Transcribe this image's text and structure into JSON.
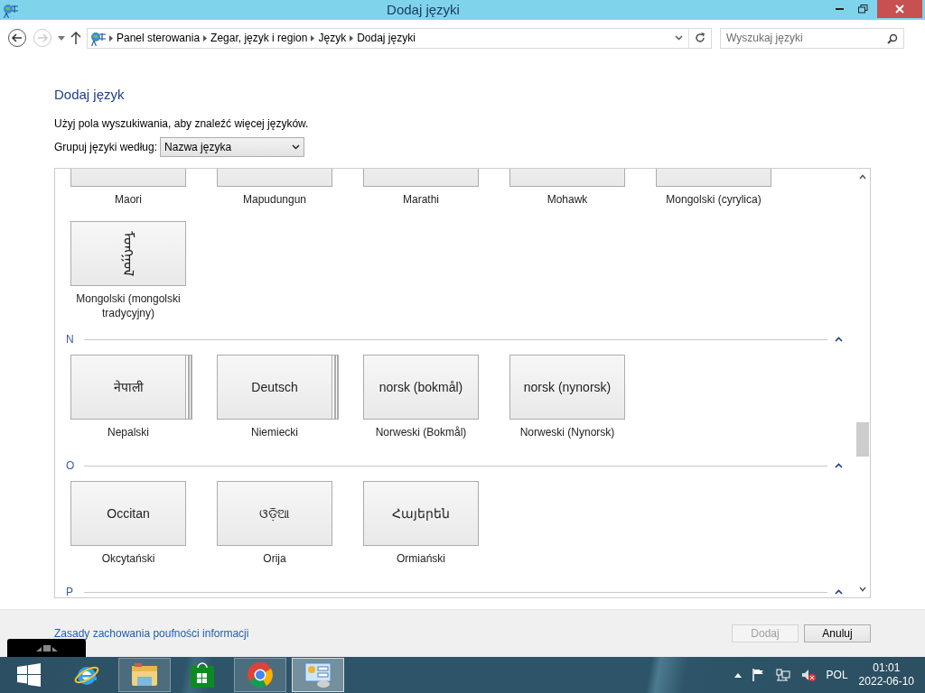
{
  "window": {
    "title": "Dodaj języki"
  },
  "address_bar": {
    "breadcrumbs": [
      "Panel sterowania",
      "Zegar, język i region",
      "Język",
      "Dodaj języki"
    ]
  },
  "search": {
    "placeholder": "Wyszukaj języki"
  },
  "heading": "Dodaj język",
  "hint": "Użyj pola wyszukiwania, aby znaleźć więcej języków.",
  "group_by": {
    "label": "Grupuj języki według:",
    "value": "Nazwa języka"
  },
  "groups": [
    {
      "items": [
        {
          "label": "Maori",
          "kind": "single"
        },
        {
          "label": "Mapudungun",
          "kind": "single"
        },
        {
          "label": "Marathi",
          "kind": "single"
        },
        {
          "label": "Mohawk",
          "kind": "single"
        },
        {
          "label": "Mongolski (cyrylica)",
          "kind": "single"
        },
        {
          "native": "ᠮᠣᠩᠭᠣᠯ",
          "label": "Mongolski (mongolski tradycyjny)",
          "kind": "vertical"
        }
      ]
    },
    {
      "letter": "N",
      "items": [
        {
          "native": "नेपाली",
          "label": "Nepalski",
          "kind": "stacked"
        },
        {
          "native": "Deutsch",
          "label": "Niemiecki",
          "kind": "stacked"
        },
        {
          "native": "norsk (bokmål)",
          "label": "Norweski (Bokmål)",
          "kind": "single"
        },
        {
          "native": "norsk (nynorsk)",
          "label": "Norweski (Nynorsk)",
          "kind": "single"
        }
      ]
    },
    {
      "letter": "O",
      "items": [
        {
          "native": "Occitan",
          "label": "Okcytański",
          "kind": "single"
        },
        {
          "native": "ଓଡ଼ିଆ",
          "label": "Orija",
          "kind": "single"
        },
        {
          "native": "Հայերեն",
          "label": "Ormiański",
          "kind": "single"
        }
      ]
    },
    {
      "letter": "P"
    }
  ],
  "footer": {
    "link": "Zasady zachowania poufności informacji",
    "buttons": [
      {
        "label": "Dodaj",
        "disabled": true
      },
      {
        "label": "Anuluj",
        "disabled": false
      }
    ]
  },
  "taskbar": {
    "apps": [
      {
        "kind": "ie",
        "running": false,
        "selected": false
      },
      {
        "kind": "explorer",
        "running": true,
        "selected": false
      },
      {
        "kind": "store",
        "running": false,
        "selected": false
      },
      {
        "kind": "chrome",
        "running": true,
        "selected": false
      },
      {
        "kind": "control",
        "running": true,
        "selected": true
      }
    ],
    "language": "POL",
    "time": "01:01",
    "date": "2022-06-10"
  }
}
